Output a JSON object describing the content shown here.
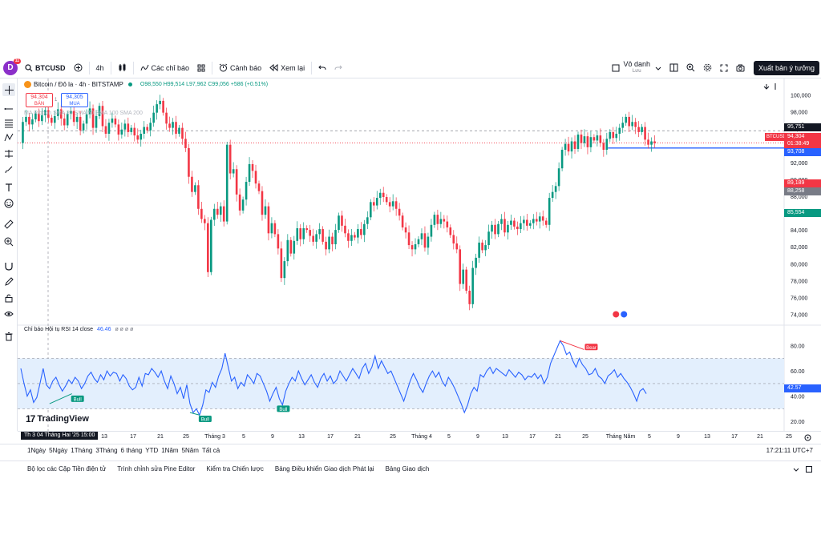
{
  "topbar": {
    "avatar_letter": "D",
    "avatar_badge": "11",
    "symbol": "BTCUSD",
    "interval": "4h",
    "indicators_label": "Các chỉ báo",
    "alert_label": "Cảnh báo",
    "replay_label": "Xem lại",
    "layout_name": "Vô danh",
    "layout_sub": "Lưu",
    "publish_label": "Xuất bản ý tưởng"
  },
  "legend": {
    "title": "Bitcoin / Đô la · 4h · BITSTAMP",
    "ohlc": "O98,550 H99,514 L97,962 C99,056 +586 (+0.51%)",
    "ma_text": "MA Ribbon SMA 20 SMA 50 SMA 100 SMA 200",
    "sell_price": "94,304",
    "sell_label": "BÁN",
    "spread": "1",
    "buy_price": "94,305",
    "buy_label": "MUA"
  },
  "price_axis": {
    "labels": [
      "100,000",
      "98,000",
      "96,000",
      "94,000",
      "92,000",
      "90,000",
      "88,000",
      "86,000",
      "84,000",
      "82,000",
      "80,000",
      "78,000",
      "76,000",
      "74,000"
    ],
    "tags": {
      "last_high": "95,751",
      "symbol_tag": "BTCUSD",
      "current_price": "94,304",
      "countdown": "01:38:49",
      "line_price": "93,708",
      "red_tag": "89,189",
      "gray_tag": "88,258",
      "green_tag": "85,554"
    }
  },
  "rsi": {
    "legend_title": "Chỉ báo Hội tụ RSI 14 close",
    "legend_value": "46.46",
    "legend_rest": "ø ø ø ø",
    "axis_labels": [
      "80.00",
      "60.00",
      "40.00",
      "20.00"
    ],
    "current": "42.57",
    "bear_label": "Bear",
    "bull_label": "Bull"
  },
  "time_axis": {
    "ticks": [
      "13",
      "17",
      "21",
      "25",
      "Tháng 3",
      "5",
      "9",
      "13",
      "17",
      "21",
      "25",
      "Tháng 4",
      "5",
      "9",
      "13",
      "17",
      "21",
      "25",
      "Tháng Năm",
      "5",
      "9",
      "13",
      "17",
      "21",
      "25"
    ],
    "cursor_date": "Th 3 04 Tháng Hai '25   15:00"
  },
  "branding": {
    "logo_text": "TradingView",
    "logo_mark": "17"
  },
  "ranges": {
    "items": [
      "1Ngày",
      "5Ngày",
      "1Tháng",
      "3Tháng",
      "6 tháng",
      "YTD",
      "1Năm",
      "5Năm",
      "Tất cả"
    ],
    "clock": "17:21:11 UTC+7"
  },
  "bottom_tabs": [
    "Bộ lọc các Cặp Tiền điện tử",
    "Trình chỉnh sửa Pine Editor",
    "Kiểm tra Chiến lược",
    "Bảng Điều khiển Giao dịch Phát lại",
    "Bảng Giao dịch"
  ],
  "colors": {
    "up": "#089981",
    "down": "#f23645",
    "rsi_line": "#2962ff",
    "band": "#e3effd",
    "accent": "#2962ff"
  },
  "chart_data": {
    "type": "candlestick",
    "symbol": "BTCUSD",
    "timeframe": "4h",
    "ylim": [
      73000,
      101000
    ],
    "close_path": [
      [
        0,
        94300
      ],
      [
        4,
        96800
      ],
      [
        8,
        97400
      ],
      [
        12,
        96500
      ],
      [
        16,
        97100
      ],
      [
        20,
        97800
      ],
      [
        24,
        96900
      ],
      [
        28,
        97600
      ],
      [
        32,
        98200
      ],
      [
        36,
        97300
      ],
      [
        40,
        96700
      ],
      [
        44,
        97500
      ],
      [
        48,
        98300
      ],
      [
        52,
        97200
      ],
      [
        56,
        96400
      ],
      [
        60,
        97800
      ],
      [
        64,
        98100
      ],
      [
        68,
        96800
      ],
      [
        72,
        97400
      ],
      [
        76,
        95800
      ],
      [
        80,
        96600
      ],
      [
        84,
        97700
      ],
      [
        88,
        98400
      ],
      [
        92,
        96100
      ],
      [
        96,
        97500
      ],
      [
        100,
        98700
      ],
      [
        104,
        96300
      ],
      [
        108,
        95400
      ],
      [
        112,
        96700
      ],
      [
        116,
        97200
      ],
      [
        120,
        96500
      ],
      [
        124,
        95300
      ],
      [
        128,
        95900
      ],
      [
        132,
        96600
      ],
      [
        136,
        95600
      ],
      [
        140,
        96100
      ],
      [
        144,
        95200
      ],
      [
        148,
        94700
      ],
      [
        152,
        95400
      ],
      [
        156,
        96200
      ],
      [
        160,
        95800
      ],
      [
        164,
        96700
      ],
      [
        168,
        97900
      ],
      [
        172,
        98900
      ],
      [
        176,
        99300
      ],
      [
        180,
        97900
      ],
      [
        184,
        96600
      ],
      [
        188,
        96100
      ],
      [
        192,
        96800
      ],
      [
        196,
        95400
      ],
      [
        200,
        96100
      ],
      [
        204,
        94800
      ],
      [
        208,
        93700
      ],
      [
        212,
        90300
      ],
      [
        216,
        88500
      ],
      [
        220,
        89300
      ],
      [
        224,
        86500
      ],
      [
        228,
        85300
      ],
      [
        232,
        84800
      ],
      [
        236,
        79000
      ],
      [
        240,
        85200
      ],
      [
        244,
        86500
      ],
      [
        248,
        85800
      ],
      [
        252,
        86800
      ],
      [
        256,
        85000
      ],
      [
        260,
        94100
      ],
      [
        264,
        90700
      ],
      [
        268,
        91200
      ],
      [
        272,
        88200
      ],
      [
        276,
        86300
      ],
      [
        280,
        87600
      ],
      [
        284,
        89700
      ],
      [
        288,
        91800
      ],
      [
        292,
        91000
      ],
      [
        296,
        89500
      ],
      [
        300,
        88600
      ],
      [
        304,
        85800
      ],
      [
        308,
        86800
      ],
      [
        312,
        83600
      ],
      [
        316,
        84800
      ],
      [
        320,
        83500
      ],
      [
        324,
        81800
      ],
      [
        328,
        78300
      ],
      [
        332,
        80300
      ],
      [
        336,
        82800
      ],
      [
        340,
        81200
      ],
      [
        344,
        82700
      ],
      [
        348,
        84200
      ],
      [
        352,
        82900
      ],
      [
        356,
        84200
      ],
      [
        360,
        84000
      ],
      [
        364,
        83300
      ],
      [
        368,
        82600
      ],
      [
        372,
        83500
      ],
      [
        376,
        84100
      ],
      [
        380,
        82600
      ],
      [
        384,
        81700
      ],
      [
        388,
        83200
      ],
      [
        392,
        82300
      ],
      [
        396,
        84000
      ],
      [
        400,
        85700
      ],
      [
        404,
        84500
      ],
      [
        408,
        83600
      ],
      [
        412,
        82700
      ],
      [
        416,
        83400
      ],
      [
        420,
        83100
      ],
      [
        424,
        84100
      ],
      [
        428,
        83400
      ],
      [
        432,
        84700
      ],
      [
        436,
        85500
      ],
      [
        440,
        87300
      ],
      [
        444,
        86900
      ],
      [
        448,
        87800
      ],
      [
        452,
        88400
      ],
      [
        456,
        87900
      ],
      [
        460,
        87300
      ],
      [
        464,
        86800
      ],
      [
        468,
        87400
      ],
      [
        472,
        86500
      ],
      [
        476,
        85700
      ],
      [
        480,
        84300
      ],
      [
        484,
        83700
      ],
      [
        488,
        82200
      ],
      [
        492,
        81700
      ],
      [
        496,
        82300
      ],
      [
        500,
        82900
      ],
      [
        504,
        83600
      ],
      [
        508,
        81900
      ],
      [
        512,
        83200
      ],
      [
        516,
        84600
      ],
      [
        520,
        85800
      ],
      [
        524,
        84700
      ],
      [
        528,
        85300
      ],
      [
        532,
        85000
      ],
      [
        536,
        84300
      ],
      [
        540,
        83400
      ],
      [
        544,
        82400
      ],
      [
        548,
        81700
      ],
      [
        552,
        77600
      ],
      [
        556,
        79300
      ],
      [
        560,
        76800
      ],
      [
        564,
        75200
      ],
      [
        568,
        79500
      ],
      [
        572,
        80700
      ],
      [
        576,
        82500
      ],
      [
        580,
        81600
      ],
      [
        584,
        82200
      ],
      [
        588,
        83800
      ],
      [
        592,
        84600
      ],
      [
        596,
        83500
      ],
      [
        600,
        84700
      ],
      [
        604,
        85300
      ],
      [
        608,
        83700
      ],
      [
        612,
        84600
      ],
      [
        616,
        85100
      ],
      [
        620,
        84400
      ],
      [
        624,
        84100
      ],
      [
        628,
        84800
      ],
      [
        632,
        85200
      ],
      [
        636,
        84500
      ],
      [
        640,
        84800
      ],
      [
        644,
        85300
      ],
      [
        648,
        85000
      ],
      [
        652,
        85600
      ],
      [
        656,
        85100
      ],
      [
        660,
        84600
      ],
      [
        664,
        87800
      ],
      [
        668,
        88500
      ],
      [
        672,
        89200
      ],
      [
        676,
        91300
      ],
      [
        680,
        93500
      ],
      [
        684,
        94200
      ],
      [
        688,
        93300
      ],
      [
        692,
        94500
      ],
      [
        696,
        93600
      ],
      [
        700,
        95300
      ],
      [
        704,
        94300
      ],
      [
        708,
        95100
      ],
      [
        712,
        93800
      ],
      [
        716,
        95000
      ],
      [
        720,
        94600
      ],
      [
        724,
        95200
      ],
      [
        728,
        94300
      ],
      [
        732,
        93500
      ],
      [
        736,
        94800
      ],
      [
        740,
        95600
      ],
      [
        744,
        94900
      ],
      [
        748,
        95400
      ],
      [
        752,
        96100
      ],
      [
        756,
        96700
      ],
      [
        760,
        97400
      ],
      [
        764,
        96300
      ],
      [
        768,
        96800
      ],
      [
        772,
        96200
      ],
      [
        776,
        95600
      ],
      [
        780,
        96200
      ],
      [
        784,
        94700
      ],
      [
        788,
        94100
      ],
      [
        792,
        94500
      ],
      [
        796,
        94300
      ]
    ],
    "rsi_path": [
      [
        0,
        62
      ],
      [
        4,
        50
      ],
      [
        8,
        40
      ],
      [
        12,
        45
      ],
      [
        16,
        35
      ],
      [
        20,
        39
      ],
      [
        24,
        50
      ],
      [
        28,
        62
      ],
      [
        32,
        49
      ],
      [
        36,
        46
      ],
      [
        40,
        52
      ],
      [
        44,
        55
      ],
      [
        48,
        49
      ],
      [
        52,
        44
      ],
      [
        56,
        48
      ],
      [
        60,
        53
      ],
      [
        64,
        50
      ],
      [
        68,
        55
      ],
      [
        72,
        52
      ],
      [
        76,
        46
      ],
      [
        80,
        50
      ],
      [
        84,
        56
      ],
      [
        88,
        59
      ],
      [
        92,
        54
      ],
      [
        96,
        51
      ],
      [
        100,
        57
      ],
      [
        104,
        53
      ],
      [
        108,
        60
      ],
      [
        112,
        56
      ],
      [
        116,
        59
      ],
      [
        120,
        58
      ],
      [
        124,
        52
      ],
      [
        128,
        57
      ],
      [
        132,
        54
      ],
      [
        136,
        48
      ],
      [
        140,
        45
      ],
      [
        144,
        47
      ],
      [
        148,
        55
      ],
      [
        152,
        48
      ],
      [
        156,
        58
      ],
      [
        160,
        57
      ],
      [
        164,
        62
      ],
      [
        168,
        59
      ],
      [
        172,
        55
      ],
      [
        176,
        60
      ],
      [
        180,
        52
      ],
      [
        184,
        46
      ],
      [
        188,
        56
      ],
      [
        192,
        50
      ],
      [
        196,
        42
      ],
      [
        200,
        47
      ],
      [
        204,
        38
      ],
      [
        208,
        49
      ],
      [
        212,
        34
      ],
      [
        216,
        27
      ],
      [
        220,
        30
      ],
      [
        224,
        25
      ],
      [
        228,
        33
      ],
      [
        232,
        45
      ],
      [
        236,
        43
      ],
      [
        240,
        51
      ],
      [
        244,
        47
      ],
      [
        248,
        56
      ],
      [
        252,
        62
      ],
      [
        256,
        74
      ],
      [
        260,
        63
      ],
      [
        264,
        52
      ],
      [
        268,
        55
      ],
      [
        272,
        46
      ],
      [
        276,
        51
      ],
      [
        280,
        48
      ],
      [
        284,
        57
      ],
      [
        288,
        54
      ],
      [
        292,
        50
      ],
      [
        296,
        58
      ],
      [
        300,
        56
      ],
      [
        304,
        50
      ],
      [
        308,
        44
      ],
      [
        312,
        36
      ],
      [
        316,
        42
      ],
      [
        320,
        47
      ],
      [
        324,
        38
      ],
      [
        328,
        33
      ],
      [
        332,
        44
      ],
      [
        336,
        50
      ],
      [
        340,
        55
      ],
      [
        344,
        52
      ],
      [
        348,
        60
      ],
      [
        352,
        54
      ],
      [
        356,
        49
      ],
      [
        360,
        53
      ],
      [
        364,
        57
      ],
      [
        368,
        51
      ],
      [
        372,
        47
      ],
      [
        376,
        54
      ],
      [
        380,
        58
      ],
      [
        384,
        52
      ],
      [
        388,
        56
      ],
      [
        392,
        50
      ],
      [
        396,
        53
      ],
      [
        400,
        60
      ],
      [
        404,
        56
      ],
      [
        408,
        52
      ],
      [
        412,
        57
      ],
      [
        416,
        62
      ],
      [
        420,
        58
      ],
      [
        424,
        54
      ],
      [
        428,
        62
      ],
      [
        432,
        66
      ],
      [
        436,
        58
      ],
      [
        440,
        63
      ],
      [
        444,
        72
      ],
      [
        448,
        62
      ],
      [
        452,
        68
      ],
      [
        456,
        63
      ],
      [
        460,
        58
      ],
      [
        464,
        60
      ],
      [
        468,
        54
      ],
      [
        472,
        48
      ],
      [
        476,
        42
      ],
      [
        480,
        36
      ],
      [
        484,
        44
      ],
      [
        488,
        52
      ],
      [
        492,
        58
      ],
      [
        496,
        53
      ],
      [
        500,
        47
      ],
      [
        504,
        43
      ],
      [
        508,
        50
      ],
      [
        512,
        56
      ],
      [
        516,
        60
      ],
      [
        520,
        55
      ],
      [
        524,
        59
      ],
      [
        528,
        52
      ],
      [
        532,
        48
      ],
      [
        536,
        55
      ],
      [
        540,
        51
      ],
      [
        544,
        46
      ],
      [
        548,
        40
      ],
      [
        552,
        34
      ],
      [
        556,
        27
      ],
      [
        560,
        33
      ],
      [
        564,
        42
      ],
      [
        568,
        47
      ],
      [
        572,
        44
      ],
      [
        576,
        57
      ],
      [
        580,
        55
      ],
      [
        584,
        60
      ],
      [
        588,
        63
      ],
      [
        592,
        58
      ],
      [
        596,
        62
      ],
      [
        600,
        60
      ],
      [
        604,
        58
      ],
      [
        608,
        56
      ],
      [
        612,
        61
      ],
      [
        616,
        58
      ],
      [
        620,
        55
      ],
      [
        624,
        59
      ],
      [
        628,
        57
      ],
      [
        632,
        53
      ],
      [
        636,
        56
      ],
      [
        640,
        55
      ],
      [
        644,
        58
      ],
      [
        648,
        54
      ],
      [
        652,
        57
      ],
      [
        656,
        50
      ],
      [
        660,
        55
      ],
      [
        664,
        66
      ],
      [
        668,
        72
      ],
      [
        672,
        78
      ],
      [
        676,
        84
      ],
      [
        680,
        80
      ],
      [
        684,
        73
      ],
      [
        688,
        75
      ],
      [
        692,
        68
      ],
      [
        696,
        63
      ],
      [
        700,
        70
      ],
      [
        704,
        65
      ],
      [
        708,
        62
      ],
      [
        712,
        57
      ],
      [
        716,
        58
      ],
      [
        720,
        62
      ],
      [
        724,
        56
      ],
      [
        728,
        54
      ],
      [
        732,
        50
      ],
      [
        736,
        56
      ],
      [
        740,
        58
      ],
      [
        744,
        61
      ],
      [
        748,
        55
      ],
      [
        752,
        58
      ],
      [
        756,
        54
      ],
      [
        760,
        51
      ],
      [
        764,
        47
      ],
      [
        768,
        42
      ],
      [
        772,
        36
      ],
      [
        776,
        44
      ],
      [
        780,
        46
      ],
      [
        784,
        42
      ]
    ],
    "rsi_ylim": [
      15,
      90
    ],
    "rsi_bands": [
      70,
      50,
      30
    ],
    "horizontal_line": 93708,
    "dashed_line": 95751,
    "signals": [
      {
        "type": "bull",
        "x": 64
      },
      {
        "type": "bull",
        "x": 224
      },
      {
        "type": "bull",
        "x": 322
      },
      {
        "type": "bear",
        "x": 708
      }
    ]
  }
}
